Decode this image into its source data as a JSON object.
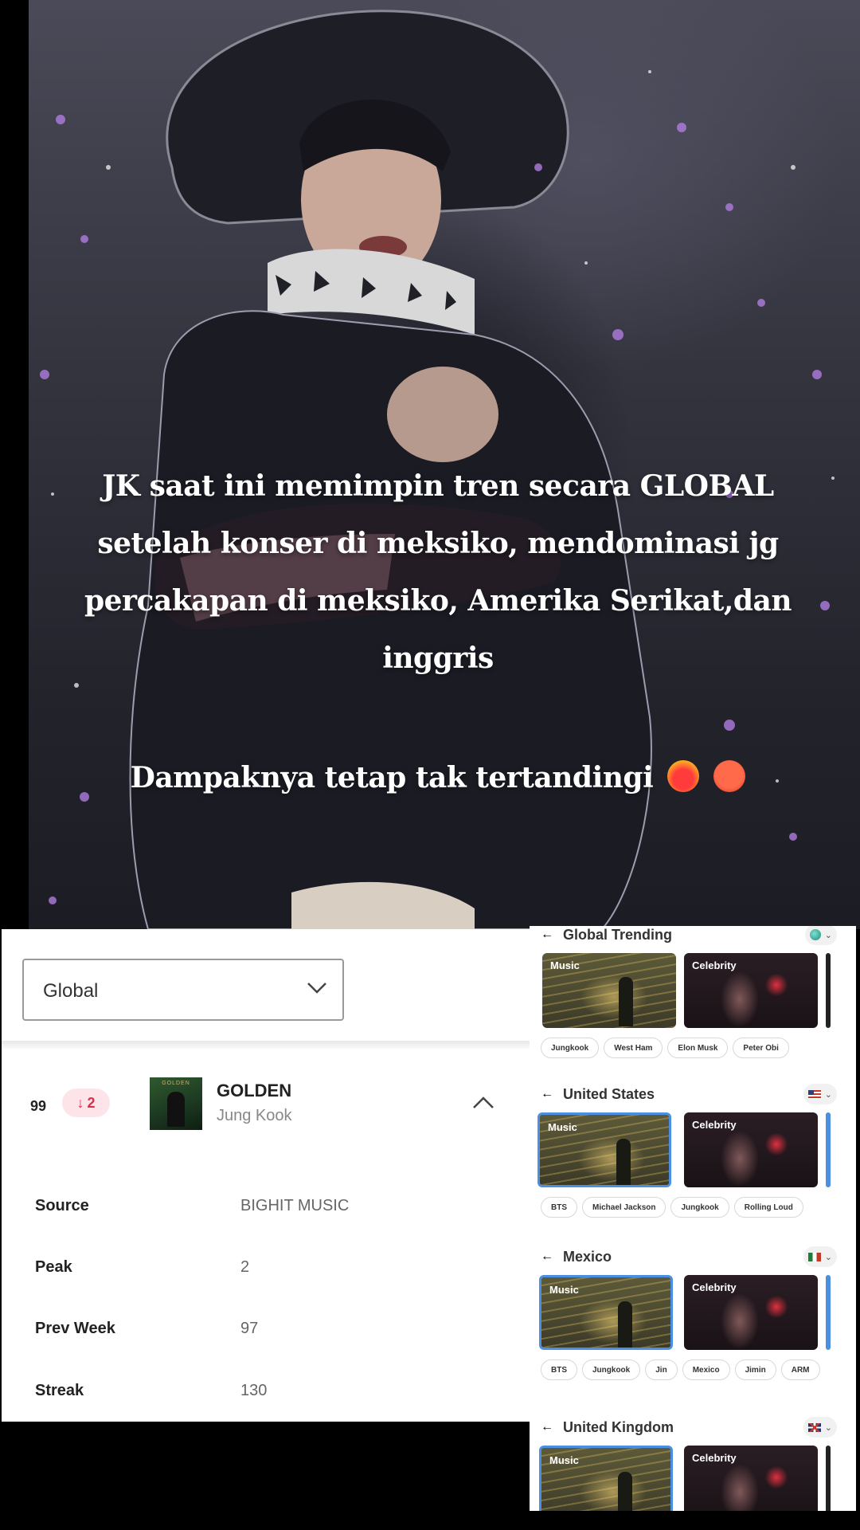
{
  "caption": {
    "lines": [
      "JK saat ini memimpin  tren secara GLOBAL",
      "setelah konser di meksiko, mendominasi jg",
      "percakapan di meksiko, Amerika Serikat,dan",
      "inggris"
    ],
    "tagline": "Dampaknya tetap tak tertandingi",
    "emojis": [
      "fire-heart-icon",
      "hot-face-icon"
    ]
  },
  "chart": {
    "region_select": "Global",
    "rank": "99",
    "change": "2",
    "change_direction": "down",
    "track": {
      "title": "GOLDEN",
      "artist": "Jung Kook",
      "album_art_text": "GOLDEN"
    },
    "stats": [
      {
        "label": "Source",
        "value": "BIGHIT MUSIC"
      },
      {
        "label": "Peak",
        "value": "2"
      },
      {
        "label": "Prev Week",
        "value": "97"
      },
      {
        "label": "Streak",
        "value": "130"
      }
    ]
  },
  "trending": {
    "sections": [
      {
        "title": "Global Trending",
        "flag": "globe-icon",
        "cards": [
          "Music",
          "Celebrity"
        ],
        "pills": [
          "Jungkook",
          "West Ham",
          "Elon Musk",
          "Peter Obi"
        ]
      },
      {
        "title": "United States",
        "flag": "us-flag-icon",
        "cards": [
          "Music",
          "Celebrity"
        ],
        "pills": [
          "BTS",
          "Michael Jackson",
          "Jungkook",
          "Rolling Loud"
        ]
      },
      {
        "title": "Mexico",
        "flag": "mexico-flag-icon",
        "cards": [
          "Music",
          "Celebrity"
        ],
        "pills": [
          "BTS",
          "Jungkook",
          "Jin",
          "Mexico",
          "Jimin",
          "ARM"
        ]
      },
      {
        "title": "United Kingdom",
        "flag": "uk-flag-icon",
        "cards": [
          "Music",
          "Celebrity"
        ],
        "pills": []
      }
    ]
  }
}
